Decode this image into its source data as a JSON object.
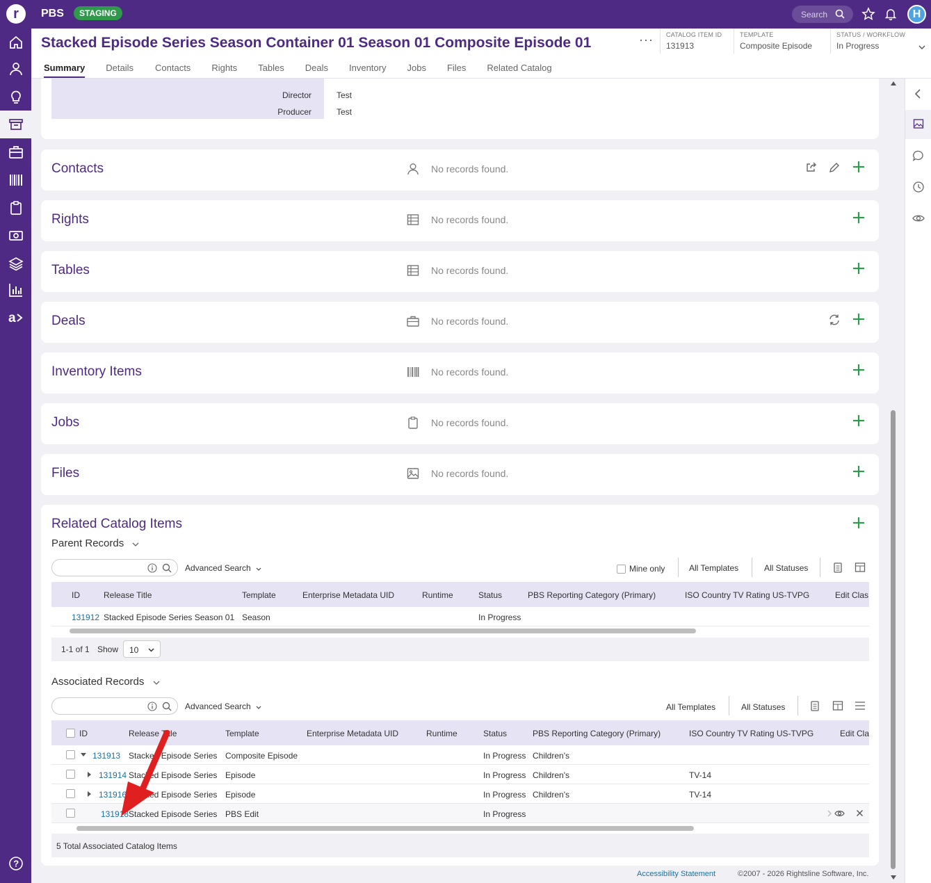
{
  "topbar": {
    "org": "PBS",
    "env_badge": "STAGING",
    "search_label": "Search",
    "avatar_initial": "H"
  },
  "header": {
    "title": "Stacked Episode Series Season Container 01 Season 01 Composite Episode 01",
    "more": "···",
    "catalog_item_id_label": "CATALOG ITEM ID",
    "catalog_item_id": "131913",
    "template_label": "TEMPLATE",
    "template": "Composite Episode",
    "status_label": "STATUS / WORKFLOW",
    "status": "In Progress"
  },
  "tabs": [
    "Summary",
    "Details",
    "Contacts",
    "Rights",
    "Tables",
    "Deals",
    "Inventory",
    "Jobs",
    "Files",
    "Related Catalog"
  ],
  "talent": {
    "rows": [
      {
        "role": "Director",
        "value": "Test"
      },
      {
        "role": "Producer",
        "value": "Test"
      }
    ]
  },
  "sections": {
    "no_records": "No records found.",
    "contacts": "Contacts",
    "rights": "Rights",
    "tables": "Tables",
    "deals": "Deals",
    "inventory": "Inventory Items",
    "jobs": "Jobs",
    "files": "Files"
  },
  "related": {
    "title": "Related Catalog Items",
    "parent": {
      "heading": "Parent Records",
      "advanced_search": "Advanced Search",
      "mine_only": "Mine only",
      "all_templates": "All Templates",
      "all_statuses": "All Statuses",
      "columns": [
        "ID",
        "Release Title",
        "Template",
        "Enterprise Metadata UID",
        "Runtime",
        "Status",
        "PBS Reporting Category (Primary)",
        "ISO Country TV Rating US-TVPG",
        "Edit Clas"
      ],
      "rows": [
        {
          "id": "131912",
          "title": "Stacked Episode Series Season 01",
          "template": "Season",
          "status": "In Progress"
        }
      ],
      "pager": {
        "count": "1-1 of 1",
        "show_label": "Show",
        "show_value": "10"
      }
    },
    "associated": {
      "heading": "Associated Records",
      "advanced_search": "Advanced Search",
      "all_templates": "All Templates",
      "all_statuses": "All Statuses",
      "columns": [
        "ID",
        "Release Title",
        "Template",
        "Enterprise Metadata UID",
        "Runtime",
        "Status",
        "PBS Reporting Category (Primary)",
        "ISO Country TV Rating US-TVPG",
        "Edit Cla"
      ],
      "rows": [
        {
          "id": "131913",
          "title": "Stacked Episode Series",
          "template": "Composite Episode",
          "status": "In Progress",
          "category": "Children's",
          "rating": ""
        },
        {
          "id": "131914",
          "title": "Stacked Episode Series",
          "template": "Episode",
          "status": "In Progress",
          "category": "Children's",
          "rating": "TV-14"
        },
        {
          "id": "131916",
          "title": "Stacked Episode Series",
          "template": "Episode",
          "status": "In Progress",
          "category": "Children's",
          "rating": "TV-14"
        },
        {
          "id": "131918",
          "title": "Stacked Episode Series",
          "template": "PBS Edit",
          "status": "In Progress",
          "category": "",
          "rating": ""
        }
      ],
      "total": "5 Total Associated Catalog Items"
    }
  },
  "footer": {
    "accessibility": "Accessibility Statement",
    "copyright": "©2007 - 2026 Rightsline Software, Inc."
  },
  "colors": {
    "brand": "#4e2a84",
    "accent_green": "#2f9a4b",
    "link": "#1c6fa3",
    "annotation_arrow": "#e02020"
  }
}
